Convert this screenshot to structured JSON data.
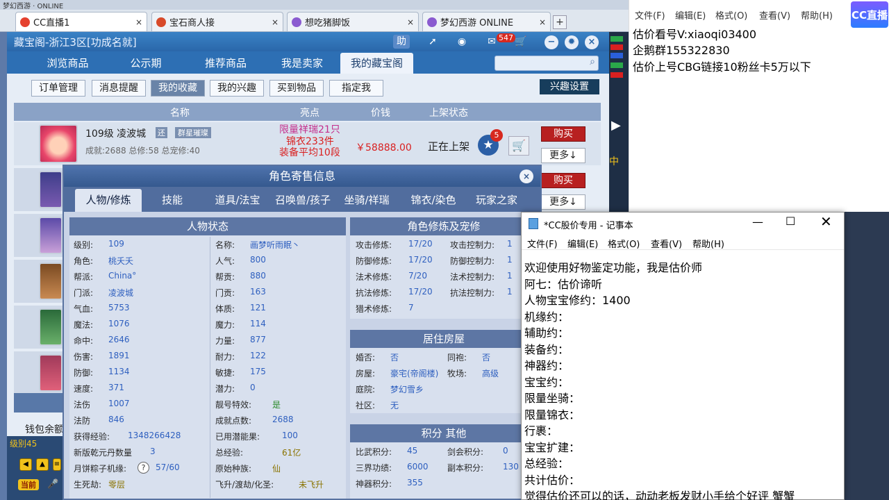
{
  "browser": {
    "top_strip": "梦幻西游 · ONLINE",
    "tabs": [
      {
        "label": "CC直播1",
        "icon": "cc-favicon",
        "active": true
      },
      {
        "label": "宝石商人接",
        "icon": "mhxy-favicon",
        "active": false
      },
      {
        "label": "想吃猪脚饭",
        "icon": "mhxy-favicon",
        "active": false
      },
      {
        "label": "梦幻西游 ONLINE",
        "icon": "mhxy-favicon",
        "active": false
      }
    ],
    "add_tab": "+"
  },
  "game": {
    "header_title": "藏宝阁-浙江3区[功成名就]",
    "help_label": "助",
    "message_count": "547",
    "nav_tabs": [
      "浏览商品",
      "公示期",
      "推荐商品",
      "我是卖家",
      "我的藏宝阁"
    ],
    "sub_buttons": [
      "订单管理",
      "消息提醒",
      "我的收藏",
      "我的兴趣",
      "买到物品",
      "指定我"
    ],
    "interest_button": "兴趣设置",
    "table_headers": [
      "名称",
      "亮点",
      "价钱",
      "上架状态"
    ],
    "row1": {
      "name": "109级 凌波城",
      "badge1": "还",
      "badge2": "群星璀璨",
      "stats": "成就:2688 总修:58 总宠修:40",
      "highlights": [
        "限量祥瑞21只",
        "锦衣233件",
        "装备平均10段"
      ],
      "price": "￥58888.00",
      "status": "正在上架",
      "star_count": "5",
      "buy": "购买",
      "more": "更多↓"
    },
    "row2": {
      "buy": "购买",
      "more": "更多↓"
    },
    "side_labels": {
      "wallet": "钱包余额",
      "level": "级别45",
      "current": "当前",
      "zhong": "中"
    }
  },
  "dialog": {
    "title": "角色寄售信息",
    "close": "×",
    "tabs": [
      "人物/修炼",
      "技能",
      "道具/法宝",
      "召唤兽/孩子",
      "坐骑/祥瑞",
      "锦衣/染色",
      "玩家之家"
    ],
    "status_panel_title": "人物状态",
    "status_left": [
      {
        "label": "级别:",
        "value": "109"
      },
      {
        "label": "角色:",
        "value": "桃夭夭"
      },
      {
        "label": "帮派:",
        "value": "China°"
      },
      {
        "label": "门派:",
        "value": "凌波城"
      },
      {
        "label": "气血:",
        "value": "5753"
      },
      {
        "label": "魔法:",
        "value": "1076"
      },
      {
        "label": "命中:",
        "value": "2646"
      },
      {
        "label": "伤害:",
        "value": "1891"
      },
      {
        "label": "防御:",
        "value": "1134"
      },
      {
        "label": "速度:",
        "value": "371"
      },
      {
        "label": "法伤",
        "value": "1007"
      },
      {
        "label": "法防",
        "value": "846"
      },
      {
        "label": "获得经验:",
        "value": "1348266428"
      },
      {
        "label": "新版乾元丹数量",
        "value": "3"
      },
      {
        "label": "月饼粽子机缘:",
        "value": "57/60"
      },
      {
        "label": "生死劫:",
        "value": "零层"
      }
    ],
    "status_right": [
      {
        "label": "名称:",
        "value": "画梦听雨眠丶"
      },
      {
        "label": "人气:",
        "value": "800"
      },
      {
        "label": "帮贡:",
        "value": "880"
      },
      {
        "label": "门贡:",
        "value": "163"
      },
      {
        "label": "体质:",
        "value": "121"
      },
      {
        "label": "魔力:",
        "value": "114"
      },
      {
        "label": "力量:",
        "value": "877"
      },
      {
        "label": "耐力:",
        "value": "122"
      },
      {
        "label": "敏捷:",
        "value": "175"
      },
      {
        "label": "潜力:",
        "value": "0"
      },
      {
        "label": "靓号特效:",
        "value": "是"
      },
      {
        "label": "成就点数:",
        "value": "2688"
      },
      {
        "label": "已用潜能果:",
        "value": "100"
      },
      {
        "label": "总经验:",
        "value": "61亿"
      },
      {
        "label": "原始种族:",
        "value": "仙"
      },
      {
        "label": "飞升/渡劫/化圣:",
        "value": "未飞升"
      }
    ],
    "cultivation_title": "角色修炼及宠修",
    "cultivation_left": [
      {
        "label": "攻击修炼:",
        "value": "17/20"
      },
      {
        "label": "防御修炼:",
        "value": "17/20"
      },
      {
        "label": "法术修炼:",
        "value": "7/20"
      },
      {
        "label": "抗法修炼:",
        "value": "17/20"
      },
      {
        "label": "猎术修炼:",
        "value": "7"
      }
    ],
    "cultivation_right": [
      {
        "label": "攻击控制力:",
        "value": "1"
      },
      {
        "label": "防御控制力:",
        "value": "1"
      },
      {
        "label": "法术控制力:",
        "value": "1"
      },
      {
        "label": "抗法控制力:",
        "value": "1"
      }
    ],
    "house_title": "居住房屋",
    "house": [
      {
        "label": "婚否:",
        "value": "否"
      },
      {
        "label": "同袍:",
        "value": "否"
      },
      {
        "label": "房屋:",
        "value": "豪宅(帝阁楼)"
      },
      {
        "label": "牧场:",
        "value": "高级"
      },
      {
        "label": "庭院:",
        "value": "梦幻雪乡"
      },
      {
        "label": "社区:",
        "value": "无"
      }
    ],
    "score_title": "积分 其他",
    "score": [
      {
        "label": "比武积分:",
        "value": "45"
      },
      {
        "label": "剑会积分:",
        "value": "0"
      },
      {
        "label": "三界功绩:",
        "value": "6000"
      },
      {
        "label": "副本积分:",
        "value": "130"
      },
      {
        "label": "神器积分:",
        "value": "355"
      }
    ]
  },
  "notepad_top": {
    "menu": [
      "文件(F)",
      "编辑(E)",
      "格式(O)",
      "查看(V)",
      "帮助(H)"
    ],
    "lines": [
      "估价看号V:xiaoqi03400",
      "企鹅群155322830",
      "估价上号CBG链接10粉丝卡5万以下"
    ],
    "cc_logo": "CC直播"
  },
  "notepad": {
    "title": "*CC股价专用 - 记事本",
    "menu": [
      "文件(F)",
      "编辑(E)",
      "格式(O)",
      "查看(V)",
      "帮助(H)"
    ],
    "lines": [
      "欢迎使用好物鉴定功能，我是估价师",
      "阿七：估价谛听",
      "人物宝宝修约：1400",
      "机缘约：",
      "辅助约：",
      "装备约：",
      "神器约：",
      "宝宝约：",
      "限量坐骑：",
      "限量锦衣：",
      "行裹：",
      "宝宝扩建：",
      "总经验：",
      "共计估价：",
      "觉得估价还可以的话，动动老板发财小手给个好评 蟹蟹"
    ]
  }
}
